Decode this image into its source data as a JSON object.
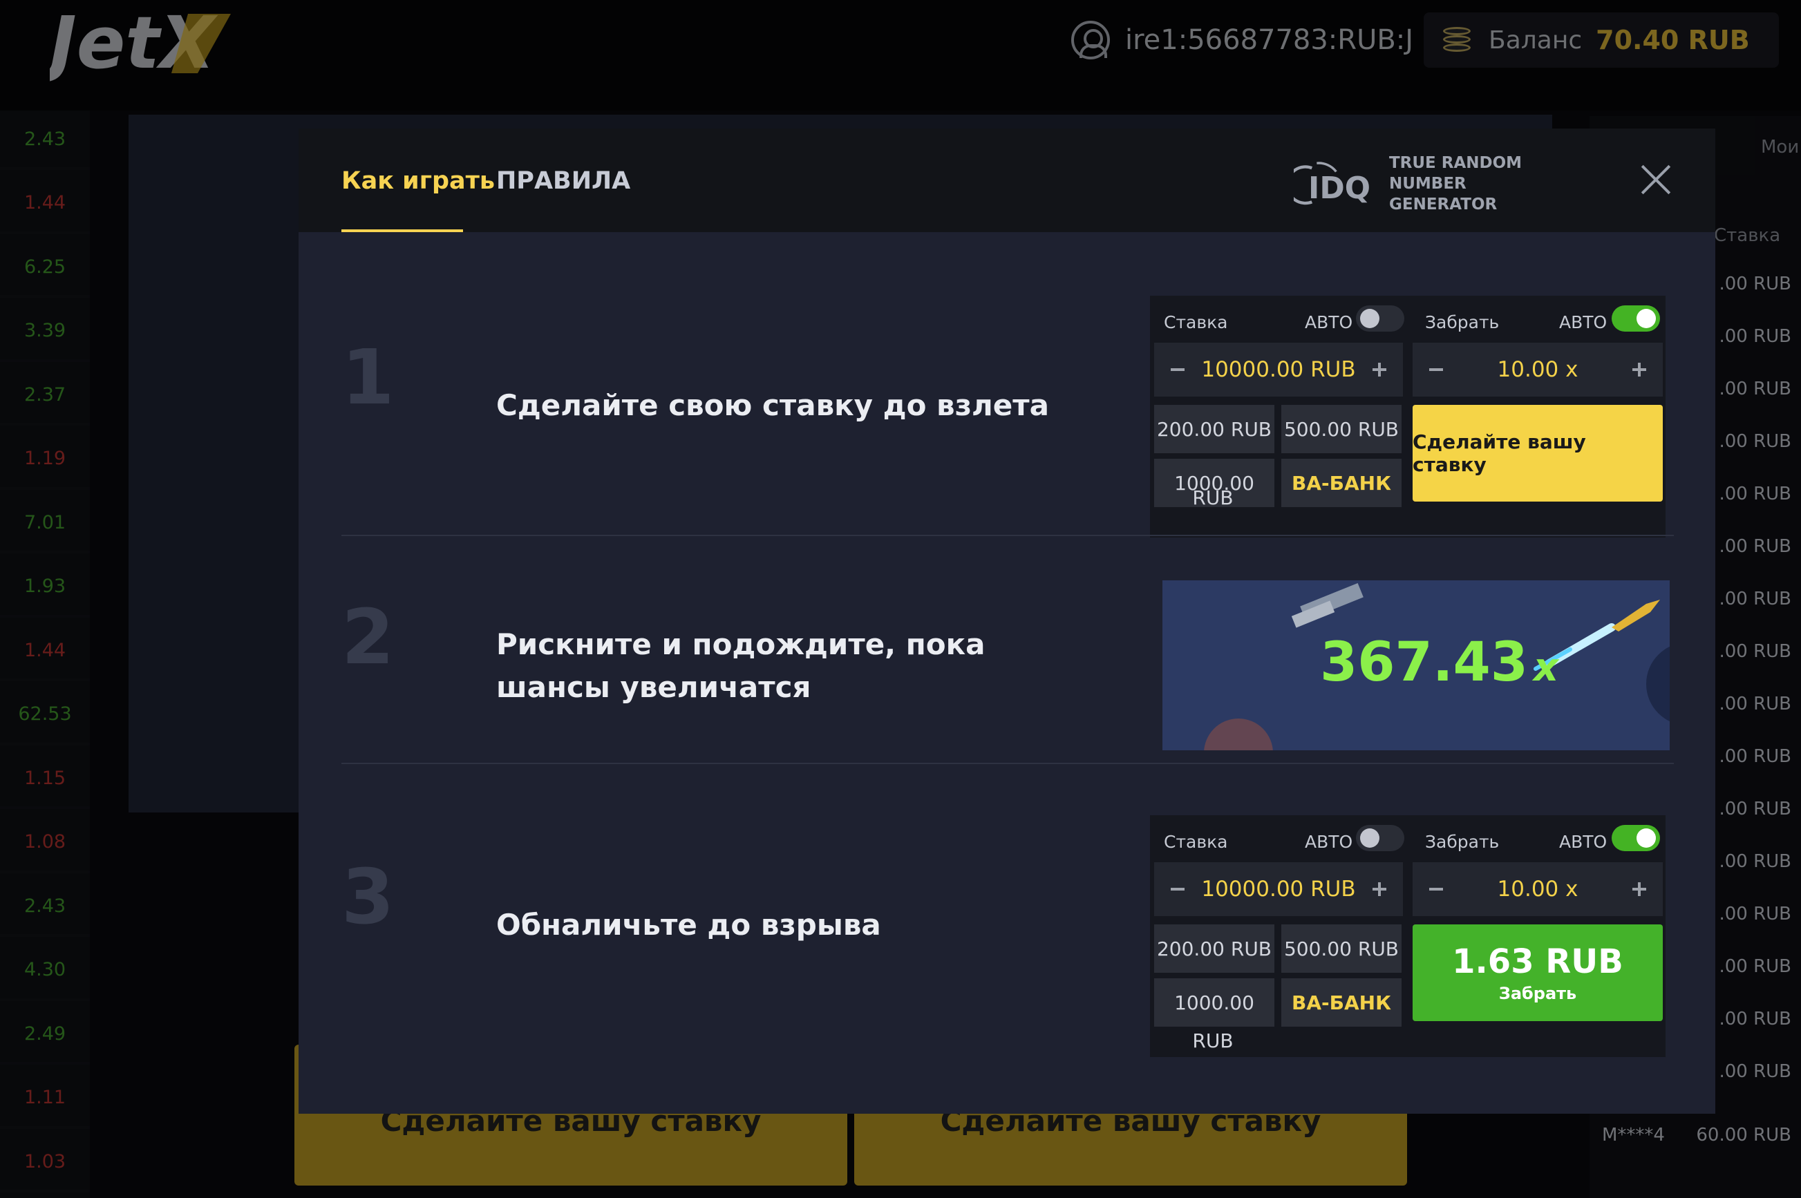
{
  "header": {
    "logo": "JetX",
    "username": "ire1:56687783:RUB:J",
    "balance_label": "Баланс",
    "balance_value": "70.40 RUB"
  },
  "history": [
    "2.43",
    "1.44",
    "6.25",
    "3.39",
    "2.37",
    "1.19",
    "7.01",
    "1.93",
    "1.44",
    "62.53",
    "1.15",
    "1.08",
    "2.43",
    "4.30",
    "2.49",
    "1.11",
    "1.03"
  ],
  "history_colors": [
    "green",
    "red",
    "green",
    "green",
    "green",
    "red",
    "green",
    "green",
    "red",
    "green",
    "red",
    "red",
    "green",
    "green",
    "green",
    "red",
    "red"
  ],
  "background_bets": {
    "left_label": "Сделайте вашу ставку",
    "right_label": "Сделайте вашу ставку"
  },
  "right_panel": {
    "title": "Мои",
    "col_header": "Ставка",
    "amounts": [
      ".00 RUB",
      ".00 RUB",
      ".00 RUB",
      ".00 RUB",
      ".00 RUB",
      ".00 RUB",
      ".00 RUB",
      ".00 RUB",
      ".00 RUB",
      ".00 RUB",
      ".00 RUB",
      ".00 RUB",
      ".00 RUB",
      ".00 RUB",
      ".00 RUB",
      ".00 RUB"
    ],
    "last_user": "M****4",
    "last_amount": "60.00 RUB"
  },
  "modal": {
    "tabs": [
      {
        "label": "Как играть",
        "active": true
      },
      {
        "label": "ПРАВИЛА",
        "active": false
      }
    ],
    "rng_logo": "IDQ",
    "rng_line1": "TRUE RANDOM",
    "rng_line2": "NUMBER GENERATOR",
    "steps": [
      {
        "num": "1",
        "text": "Сделайте свою ставку до взлета"
      },
      {
        "num": "2",
        "text": "Рискните и подождите, пока шансы увеличатся"
      },
      {
        "num": "3",
        "text": "Обналичьте до взрыва"
      }
    ],
    "widget": {
      "bet_label": "Ставка",
      "auto_label": "АВТО",
      "cashout_label": "Забрать",
      "bet_value": "10000.00 RUB",
      "cashout_value": "10.00 x",
      "chips": [
        "200.00 RUB",
        "500.00 RUB",
        "1000.00",
        "ВА-БАНК"
      ],
      "chip_rub": "RUB",
      "place_bet": "Сделайте вашу ставку",
      "cashout_amount": "1.63 RUB",
      "cashout_button_label": "Забрать"
    },
    "preview_multiplier": "367.43",
    "preview_x": "x"
  },
  "colors": {
    "accent_yellow": "#f5d447",
    "accent_green": "#44b22a",
    "multiplier_green": "#8bf04a",
    "modal_bg": "#1e2130"
  }
}
